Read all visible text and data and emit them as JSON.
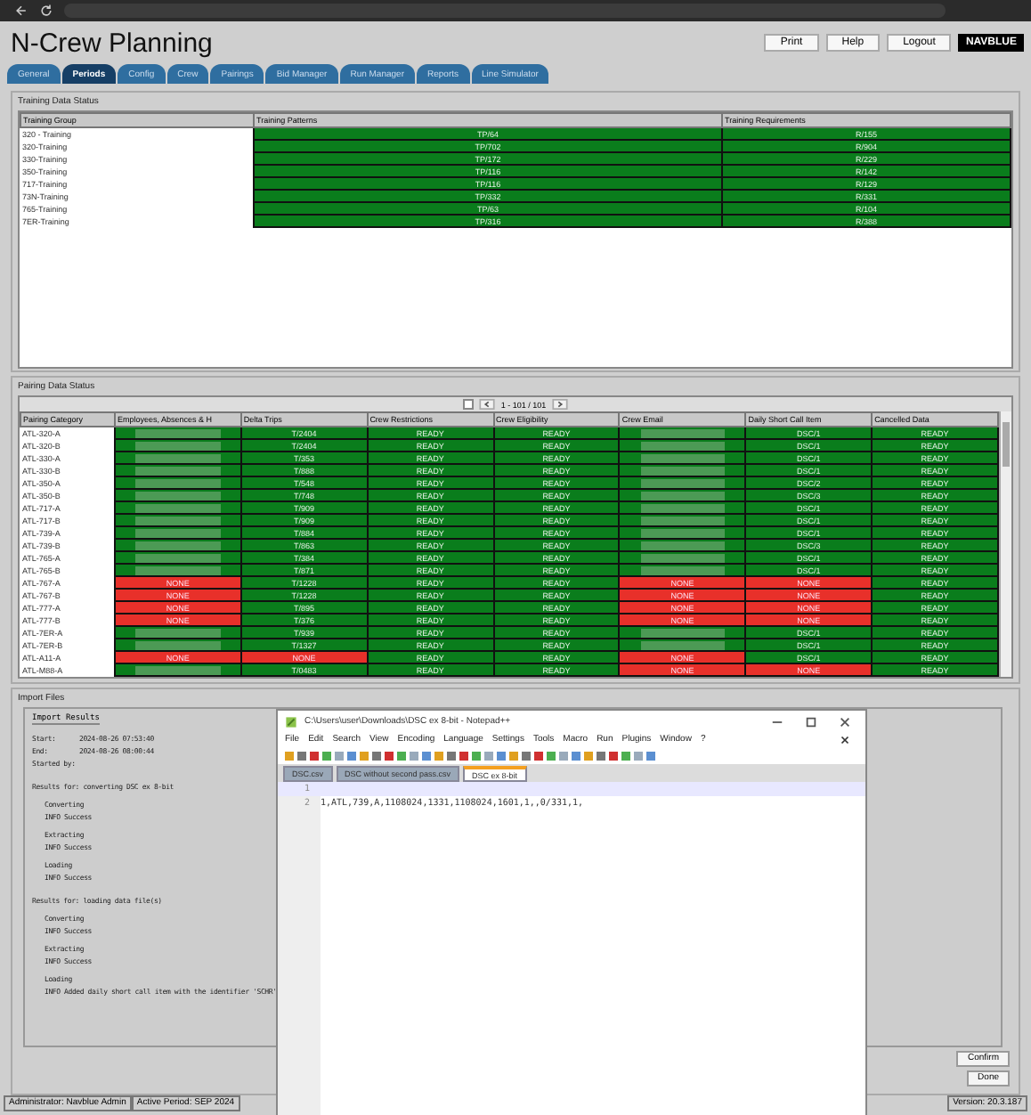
{
  "app": {
    "title": "N-Crew Planning",
    "buttons": [
      "Print",
      "Help",
      "Logout"
    ],
    "logo": "NAVBLUE"
  },
  "tabs": [
    {
      "label": "General",
      "selected": false
    },
    {
      "label": "Periods",
      "selected": true
    },
    {
      "label": "Config",
      "selected": false
    },
    {
      "label": "Crew",
      "selected": false
    },
    {
      "label": "Pairings",
      "selected": false
    },
    {
      "label": "Bid Manager",
      "selected": false
    },
    {
      "label": "Run Manager",
      "selected": false
    },
    {
      "label": "Reports",
      "selected": false
    },
    {
      "label": "Line Simulator",
      "selected": false
    }
  ],
  "training": {
    "legend": "Training Data Status",
    "columns": [
      "Training Group",
      "Training Patterns",
      "Training Requirements"
    ],
    "rows": [
      [
        "320 - Training",
        "TP/64",
        "R/155"
      ],
      [
        "320-Training",
        "TP/702",
        "R/904"
      ],
      [
        "330-Training",
        "TP/172",
        "R/229"
      ],
      [
        "350-Training",
        "TP/116",
        "R/142"
      ],
      [
        "717-Training",
        "TP/116",
        "R/129"
      ],
      [
        "73N-Training",
        "TP/332",
        "R/331"
      ],
      [
        "765-Training",
        "TP/63",
        "R/104"
      ],
      [
        "7ER-Training",
        "TP/316",
        "R/388"
      ]
    ]
  },
  "pairing": {
    "legend": "Pairing Data Status",
    "select_all": {
      "checked": false
    },
    "pager": "1 - 101 / 101",
    "columns": [
      "Pairing Category",
      "Employees, Absences & H",
      "Delta Trips",
      "Crew Restrictions",
      "Crew Eligibility",
      "Crew Email",
      "Daily Short Call Item",
      "Cancelled Data"
    ],
    "rows": [
      [
        {
          "kind": "label",
          "text": "ATL-320-A"
        },
        {
          "kind": "redacted"
        },
        {
          "kind": "ok",
          "text": "T/2404"
        },
        {
          "kind": "ok",
          "text": "READY"
        },
        {
          "kind": "ok",
          "text": "READY"
        },
        {
          "kind": "redacted"
        },
        {
          "kind": "ok",
          "text": "DSC/1"
        },
        {
          "kind": "ok",
          "text": "READY"
        }
      ],
      [
        {
          "kind": "label",
          "text": "ATL-320-B"
        },
        {
          "kind": "redacted"
        },
        {
          "kind": "ok",
          "text": "T/2404"
        },
        {
          "kind": "ok",
          "text": "READY"
        },
        {
          "kind": "ok",
          "text": "READY"
        },
        {
          "kind": "redacted"
        },
        {
          "kind": "ok",
          "text": "DSC/1"
        },
        {
          "kind": "ok",
          "text": "READY"
        }
      ],
      [
        {
          "kind": "label",
          "text": "ATL-330-A"
        },
        {
          "kind": "redacted"
        },
        {
          "kind": "ok",
          "text": "T/353"
        },
        {
          "kind": "ok",
          "text": "READY"
        },
        {
          "kind": "ok",
          "text": "READY"
        },
        {
          "kind": "redacted"
        },
        {
          "kind": "ok",
          "text": "DSC/1"
        },
        {
          "kind": "ok",
          "text": "READY"
        }
      ],
      [
        {
          "kind": "label",
          "text": "ATL-330-B"
        },
        {
          "kind": "redacted"
        },
        {
          "kind": "ok",
          "text": "T/888"
        },
        {
          "kind": "ok",
          "text": "READY"
        },
        {
          "kind": "ok",
          "text": "READY"
        },
        {
          "kind": "redacted"
        },
        {
          "kind": "ok",
          "text": "DSC/1"
        },
        {
          "kind": "ok",
          "text": "READY"
        }
      ],
      [
        {
          "kind": "label",
          "text": "ATL-350-A"
        },
        {
          "kind": "redacted"
        },
        {
          "kind": "ok",
          "text": "T/548"
        },
        {
          "kind": "ok",
          "text": "READY"
        },
        {
          "kind": "ok",
          "text": "READY"
        },
        {
          "kind": "redacted"
        },
        {
          "kind": "ok",
          "text": "DSC/2"
        },
        {
          "kind": "ok",
          "text": "READY"
        }
      ],
      [
        {
          "kind": "label",
          "text": "ATL-350-B"
        },
        {
          "kind": "redacted"
        },
        {
          "kind": "ok",
          "text": "T/748"
        },
        {
          "kind": "ok",
          "text": "READY"
        },
        {
          "kind": "ok",
          "text": "READY"
        },
        {
          "kind": "redacted"
        },
        {
          "kind": "ok",
          "text": "DSC/3"
        },
        {
          "kind": "ok",
          "text": "READY"
        }
      ],
      [
        {
          "kind": "label",
          "text": "ATL-717-A"
        },
        {
          "kind": "redacted"
        },
        {
          "kind": "ok",
          "text": "T/909"
        },
        {
          "kind": "ok",
          "text": "READY"
        },
        {
          "kind": "ok",
          "text": "READY"
        },
        {
          "kind": "redacted"
        },
        {
          "kind": "ok",
          "text": "DSC/1"
        },
        {
          "kind": "ok",
          "text": "READY"
        }
      ],
      [
        {
          "kind": "label",
          "text": "ATL-717-B"
        },
        {
          "kind": "redacted"
        },
        {
          "kind": "ok",
          "text": "T/909"
        },
        {
          "kind": "ok",
          "text": "READY"
        },
        {
          "kind": "ok",
          "text": "READY"
        },
        {
          "kind": "redacted"
        },
        {
          "kind": "ok",
          "text": "DSC/1"
        },
        {
          "kind": "ok",
          "text": "READY"
        }
      ],
      [
        {
          "kind": "label",
          "text": "ATL-739-A"
        },
        {
          "kind": "redacted"
        },
        {
          "kind": "ok",
          "text": "T/884"
        },
        {
          "kind": "ok",
          "text": "READY"
        },
        {
          "kind": "ok",
          "text": "READY"
        },
        {
          "kind": "redacted"
        },
        {
          "kind": "ok",
          "text": "DSC/1"
        },
        {
          "kind": "ok",
          "text": "READY"
        }
      ],
      [
        {
          "kind": "label",
          "text": "ATL-739-B"
        },
        {
          "kind": "redacted"
        },
        {
          "kind": "ok",
          "text": "T/863"
        },
        {
          "kind": "ok",
          "text": "READY"
        },
        {
          "kind": "ok",
          "text": "READY"
        },
        {
          "kind": "redacted"
        },
        {
          "kind": "ok",
          "text": "DSC/3"
        },
        {
          "kind": "ok",
          "text": "READY"
        }
      ],
      [
        {
          "kind": "label",
          "text": "ATL-765-A"
        },
        {
          "kind": "redacted"
        },
        {
          "kind": "ok",
          "text": "T/384"
        },
        {
          "kind": "ok",
          "text": "READY"
        },
        {
          "kind": "ok",
          "text": "READY"
        },
        {
          "kind": "redacted"
        },
        {
          "kind": "ok",
          "text": "DSC/1"
        },
        {
          "kind": "ok",
          "text": "READY"
        }
      ],
      [
        {
          "kind": "label",
          "text": "ATL-765-B"
        },
        {
          "kind": "redacted"
        },
        {
          "kind": "ok",
          "text": "T/871"
        },
        {
          "kind": "ok",
          "text": "READY"
        },
        {
          "kind": "ok",
          "text": "READY"
        },
        {
          "kind": "redacted"
        },
        {
          "kind": "ok",
          "text": "DSC/1"
        },
        {
          "kind": "ok",
          "text": "READY"
        }
      ],
      [
        {
          "kind": "label",
          "text": "ATL-767-A"
        },
        {
          "kind": "none",
          "text": "NONE"
        },
        {
          "kind": "ok",
          "text": "T/1228"
        },
        {
          "kind": "ok",
          "text": "READY"
        },
        {
          "kind": "ok",
          "text": "READY"
        },
        {
          "kind": "none",
          "text": "NONE"
        },
        {
          "kind": "none",
          "text": "NONE"
        },
        {
          "kind": "ok",
          "text": "READY"
        }
      ],
      [
        {
          "kind": "label",
          "text": "ATL-767-B"
        },
        {
          "kind": "none",
          "text": "NONE"
        },
        {
          "kind": "ok",
          "text": "T/1228"
        },
        {
          "kind": "ok",
          "text": "READY"
        },
        {
          "kind": "ok",
          "text": "READY"
        },
        {
          "kind": "none",
          "text": "NONE"
        },
        {
          "kind": "none",
          "text": "NONE"
        },
        {
          "kind": "ok",
          "text": "READY"
        }
      ],
      [
        {
          "kind": "label",
          "text": "ATL-777-A"
        },
        {
          "kind": "none",
          "text": "NONE"
        },
        {
          "kind": "ok",
          "text": "T/895"
        },
        {
          "kind": "ok",
          "text": "READY"
        },
        {
          "kind": "ok",
          "text": "READY"
        },
        {
          "kind": "none",
          "text": "NONE"
        },
        {
          "kind": "none",
          "text": "NONE"
        },
        {
          "kind": "ok",
          "text": "READY"
        }
      ],
      [
        {
          "kind": "label",
          "text": "ATL-777-B"
        },
        {
          "kind": "none",
          "text": "NONE"
        },
        {
          "kind": "ok",
          "text": "T/376"
        },
        {
          "kind": "ok",
          "text": "READY"
        },
        {
          "kind": "ok",
          "text": "READY"
        },
        {
          "kind": "none",
          "text": "NONE"
        },
        {
          "kind": "none",
          "text": "NONE"
        },
        {
          "kind": "ok",
          "text": "READY"
        }
      ],
      [
        {
          "kind": "label",
          "text": "ATL-7ER-A"
        },
        {
          "kind": "redacted"
        },
        {
          "kind": "ok",
          "text": "T/939"
        },
        {
          "kind": "ok",
          "text": "READY"
        },
        {
          "kind": "ok",
          "text": "READY"
        },
        {
          "kind": "redacted"
        },
        {
          "kind": "ok",
          "text": "DSC/1"
        },
        {
          "kind": "ok",
          "text": "READY"
        }
      ],
      [
        {
          "kind": "label",
          "text": "ATL-7ER-B"
        },
        {
          "kind": "redacted"
        },
        {
          "kind": "ok",
          "text": "T/1327"
        },
        {
          "kind": "ok",
          "text": "READY"
        },
        {
          "kind": "ok",
          "text": "READY"
        },
        {
          "kind": "redacted"
        },
        {
          "kind": "ok",
          "text": "DSC/1"
        },
        {
          "kind": "ok",
          "text": "READY"
        }
      ],
      [
        {
          "kind": "label",
          "text": "ATL-A11-A"
        },
        {
          "kind": "none",
          "text": "NONE"
        },
        {
          "kind": "none",
          "text": "NONE"
        },
        {
          "kind": "ok",
          "text": "READY"
        },
        {
          "kind": "ok",
          "text": "READY"
        },
        {
          "kind": "none",
          "text": "NONE"
        },
        {
          "kind": "ok",
          "text": "DSC/1"
        },
        {
          "kind": "ok",
          "text": "READY"
        }
      ],
      [
        {
          "kind": "label",
          "text": "ATL-M88-A"
        },
        {
          "kind": "redacted"
        },
        {
          "kind": "ok",
          "text": "T/0483"
        },
        {
          "kind": "ok",
          "text": "READY"
        },
        {
          "kind": "ok",
          "text": "READY"
        },
        {
          "kind": "none",
          "text": "NONE"
        },
        {
          "kind": "none",
          "text": "NONE"
        },
        {
          "kind": "ok",
          "text": "READY"
        }
      ]
    ]
  },
  "import": {
    "legend": "Import Files",
    "results_title": "Import Results",
    "log": [
      {
        "kind": "info",
        "text": "Start:      2024-08-26 07:53:40"
      },
      {
        "kind": "info",
        "text": "End:        2024-08-26 08:00:44"
      },
      {
        "kind": "info",
        "text": "Started by:"
      },
      {
        "kind": "heading",
        "text": "Results for: converting DSC ex 8-bit"
      },
      {
        "kind": "step",
        "text": "Converting"
      },
      {
        "kind": "message",
        "text": "INFO Success"
      },
      {
        "kind": "step",
        "text": "Extracting"
      },
      {
        "kind": "message",
        "text": "INFO Success"
      },
      {
        "kind": "step",
        "text": "Loading"
      },
      {
        "kind": "message",
        "text": "INFO Success"
      },
      {
        "kind": "heading",
        "text": "Results for: loading data file(s)"
      },
      {
        "kind": "step",
        "text": "Converting"
      },
      {
        "kind": "message",
        "text": "INFO Success"
      },
      {
        "kind": "step",
        "text": "Extracting"
      },
      {
        "kind": "message",
        "text": "INFO Success"
      },
      {
        "kind": "step",
        "text": "Loading"
      },
      {
        "kind": "message",
        "text": "INFO Added daily short call item with the identifier 'SCHR'"
      }
    ]
  },
  "notepad": {
    "title": "C:\\Users\\user\\Downloads\\DSC ex 8-bit - Notepad++",
    "menu": [
      "File",
      "Edit",
      "Search",
      "View",
      "Encoding",
      "Language",
      "Settings",
      "Tools",
      "Macro",
      "Run",
      "Plugins",
      "Window",
      "?"
    ],
    "tabs": [
      {
        "label": "DSC.csv",
        "selected": false
      },
      {
        "label": "DSC without second pass.csv",
        "selected": false
      },
      {
        "label": "DSC ex 8-bit",
        "selected": true
      }
    ],
    "lines": [
      {
        "number": "1"
      },
      {
        "number": "2",
        "text": "1,ATL,739,A,1108024,1331,1108024,1601,1,,0/331,1,"
      }
    ]
  },
  "actions": [
    "Confirm",
    "Done"
  ],
  "status_bar": {
    "user": "Administrator: Navblue Admin",
    "period": "Active Period: SEP 2024",
    "version": "Version: 20.3.187"
  }
}
